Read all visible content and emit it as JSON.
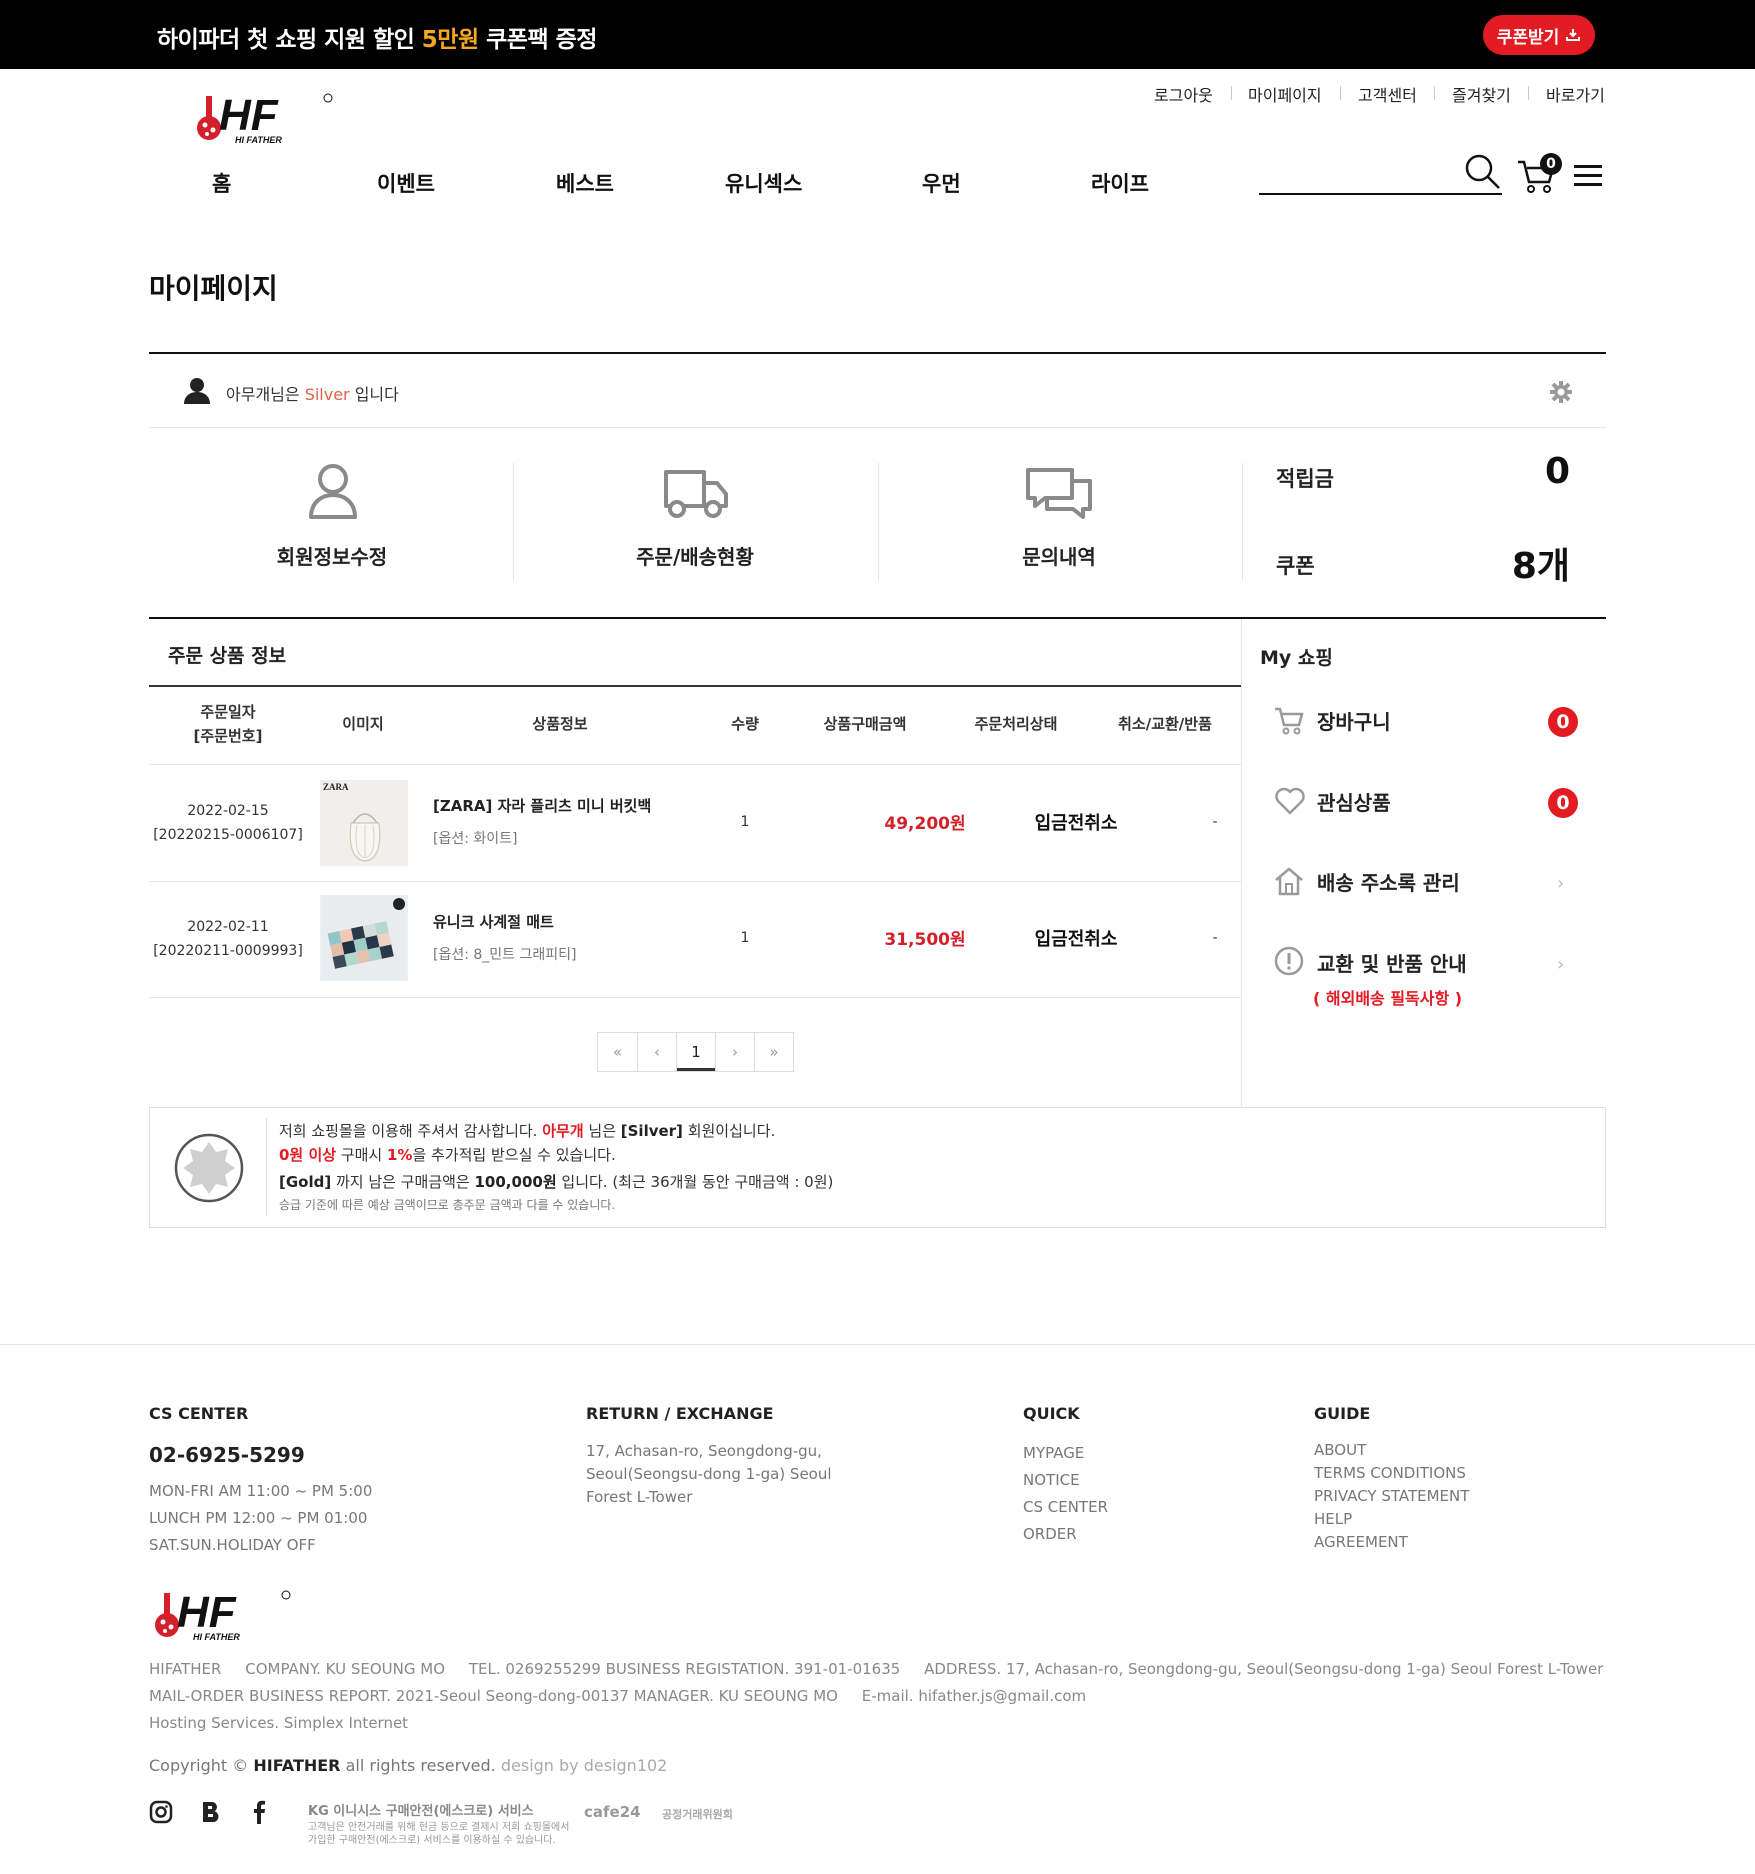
{
  "topbar": {
    "message_pre": "하이파더 첫 쇼핑 지원 할인 ",
    "message_highlight": "5만원",
    "message_post": " 쿠폰팩 증정",
    "coupon_button": "쿠폰받기"
  },
  "util_links": [
    "로그아웃",
    "마이페이지",
    "고객센터",
    "즐겨찾기",
    "바로가기"
  ],
  "logo": {
    "text": "HF",
    "sub": "HI FATHER"
  },
  "nav": [
    "홈",
    "이벤트",
    "베스트",
    "유니섹스",
    "우먼",
    "라이프"
  ],
  "header": {
    "search_placeholder": "",
    "cart_count": "0"
  },
  "page_title": "마이페이지",
  "member": {
    "name_pre": "아무개님은 ",
    "grade": "Silver",
    "name_post": " 입니다"
  },
  "quick_menu": [
    {
      "label": "회원정보수정",
      "icon": "user-icon"
    },
    {
      "label": "주문/배송현황",
      "icon": "truck-icon"
    },
    {
      "label": "문의내역",
      "icon": "chat-icon"
    }
  ],
  "summary": {
    "points_label": "적립금",
    "points_value": "0",
    "coupon_label": "쿠폰",
    "coupon_value": "8개"
  },
  "orders": {
    "title": "주문 상품 정보",
    "headers": [
      "주문일자",
      "[주문번호]",
      "이미지",
      "상품정보",
      "수량",
      "상품구매금액",
      "주문처리상태",
      "취소/교환/반품"
    ],
    "rows": [
      {
        "date": "2022-02-15",
        "order_no": "[20220215-0006107]",
        "name": "[ZARA] 자라 플리츠 미니 버킷백",
        "option": "[옵션: 화이트]",
        "qty": "1",
        "price": "49,200원",
        "status": "입금전취소",
        "cancel": "-",
        "brand": "ZARA"
      },
      {
        "date": "2022-02-11",
        "order_no": "[20220211-0009993]",
        "name": "유니크 사계절 매트",
        "option": "[옵션: 8_민트 그래피티]",
        "qty": "1",
        "price": "31,500원",
        "status": "입금전취소",
        "cancel": "-",
        "brand": ""
      }
    ],
    "pagination": {
      "first": "«",
      "prev": "‹",
      "current": "1",
      "next": "›",
      "last": "»"
    }
  },
  "my_shopping": {
    "title": "My 쇼핑",
    "items": [
      {
        "label": "장바구니",
        "count": "0",
        "icon": "cart-icon"
      },
      {
        "label": "관심상품",
        "count": "0",
        "icon": "heart-icon"
      },
      {
        "label": "배송 주소록 관리",
        "icon": "home-icon"
      },
      {
        "label": "교환 및 반품 안내",
        "icon": "exclamation-icon",
        "note": "( 해외배송 필독사항 )"
      }
    ]
  },
  "benefit": {
    "line1_pre": "저희 쇼핑몰을 이용해 주셔서 감사합니다. ",
    "line1_name": "아무개",
    "line1_mid": " 님은 ",
    "line1_grade": "[Silver]",
    "line1_post": " 회원이십니다.",
    "line2_amount": "0원 이상",
    "line2_mid": " 구매시 ",
    "line2_rate": "1%",
    "line2_post": "을 추가적립 받으실 수 있습니다.",
    "line3_grade": "[Gold]",
    "line3_mid": " 까지 남은 구매금액은 ",
    "line3_amount": "100,000원",
    "line3_post": " 입니다. (최근 36개월 동안 구매금액 : 0원)",
    "line4": "승급 기준에 따른 예상 금액이므로 총주문 금액과 다를 수 있습니다."
  },
  "footer": {
    "cs": {
      "title": "CS CENTER",
      "phone": "02-6925-5299",
      "lines": [
        "MON-FRI AM 11:00 ~ PM 5:00",
        "LUNCH PM 12:00 ~ PM 01:00",
        "SAT.SUN.HOLIDAY OFF"
      ]
    },
    "return": {
      "title": "RETURN / EXCHANGE",
      "lines": [
        "17, Achasan-ro, Seongdong-gu,",
        "Seoul(Seongsu-dong 1-ga) Seoul",
        "Forest L-Tower"
      ]
    },
    "quick": {
      "title": "QUICK",
      "links": [
        "MYPAGE",
        "NOTICE",
        "CS CENTER",
        "ORDER"
      ]
    },
    "guide": {
      "title": "GUIDE",
      "links": [
        "ABOUT",
        "TERMS CONDITIONS",
        "PRIVACY STATEMENT",
        "HELP",
        "AGREEMENT"
      ]
    },
    "info1": "HIFATHER     COMPANY. KU SEOUNG MO     TEL. 0269255299 BUSINESS REGISTATION. 391-01-01635     ADDRESS. 17, Achasan-ro, Seongdong-gu, Seoul(Seongsu-dong 1-ga) Seoul Forest L-Tower",
    "info2": "MAIL-ORDER BUSINESS REPORT. 2021-Seoul Seong-dong-00137 MANAGER. KU SEOUNG MO     E-mail. hifather.js@gmail.com",
    "info3": "Hosting Services. Simplex Internet",
    "copyright_pre": "Copyright © ",
    "copyright_brand": "HIFATHER",
    "copyright_post": " all rights reserved. ",
    "copyright_design": "design by design102",
    "cert_kg": "KG 이니시스 구매안전(에스크로) 서비스",
    "cert_kg_sub1": "고객님은 안전거래를 위해 현금 등으로 결제시 저희 쇼핑몰에서",
    "cert_kg_sub2": "가입한 구매안전(에스크로) 서비스를 이용하실 수 있습니다.",
    "cert_cafe": "cafe24",
    "cert_ftc": "공정거래위원회"
  }
}
